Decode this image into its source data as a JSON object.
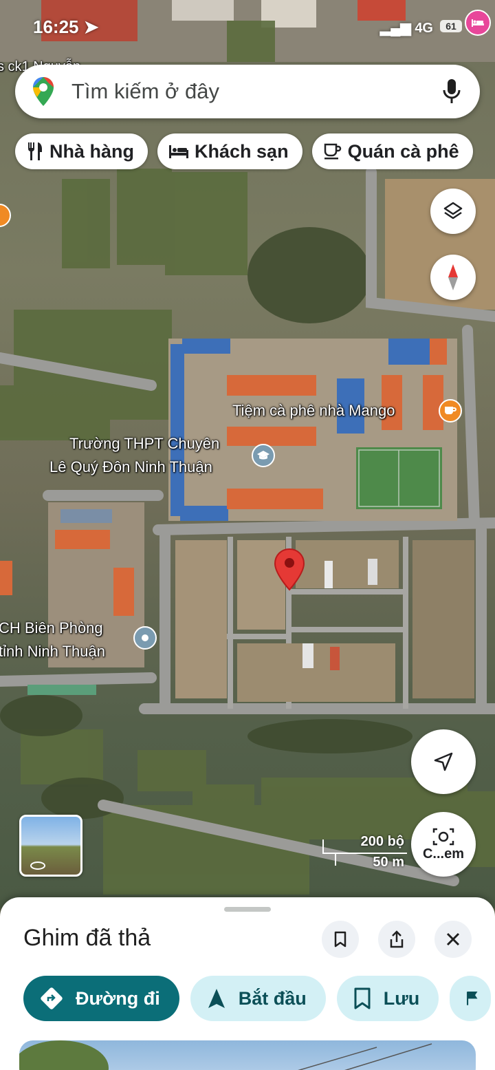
{
  "status_bar": {
    "time": "16:25",
    "network": "4G",
    "battery": "61"
  },
  "search": {
    "placeholder": "Tìm kiếm ở đây"
  },
  "chips": [
    {
      "label": "Nhà hàng",
      "icon": "restaurant-icon"
    },
    {
      "label": "Khách sạn",
      "icon": "hotel-icon"
    },
    {
      "label": "Quán cà phê",
      "icon": "coffee-icon"
    }
  ],
  "map": {
    "labels": {
      "cafe": "Tiệm cà phê nhà Mango",
      "school_line1": "Trường THPT Chuyên",
      "school_line2": "Lê Quý Đôn Ninh Thuận",
      "border_line1": "CH Biên Phòng",
      "border_line2": "tỉnh Ninh Thuận",
      "top_left_fragment": "s ck1 Nguyễn"
    },
    "scale": {
      "feet": "200 bộ",
      "meters": "50 m"
    },
    "camera_label": "C...em"
  },
  "sheet": {
    "title": "Ghim đã thả",
    "actions": {
      "directions": "Đường đi",
      "start": "Bắt đầu",
      "save": "Lưu"
    }
  },
  "colors": {
    "primary_button": "#0b6e78",
    "secondary_button": "#d3f0f5",
    "pin_red": "#e53935",
    "cafe_pin": "#f08a24",
    "hotel_pin": "#e8479a"
  }
}
